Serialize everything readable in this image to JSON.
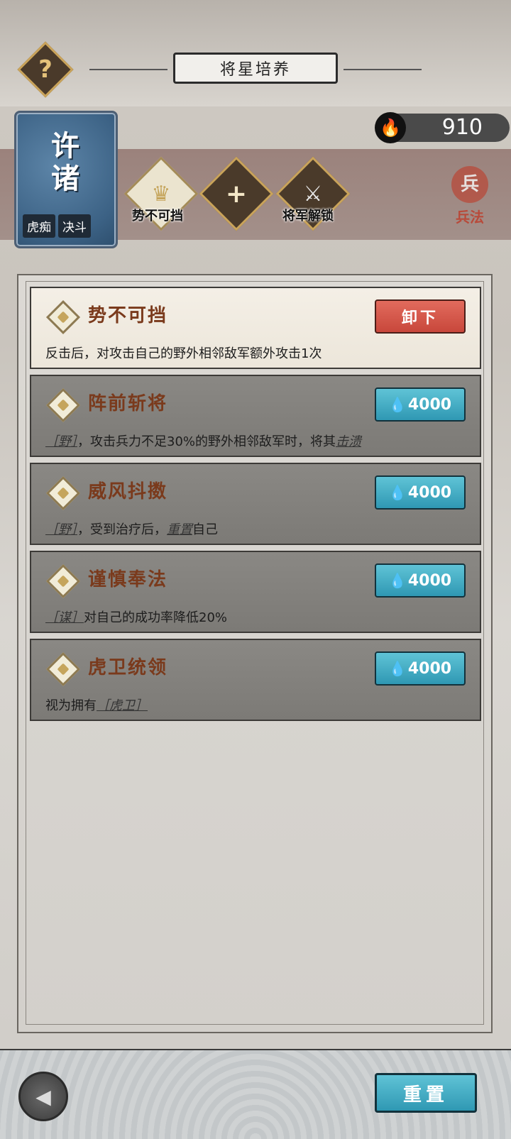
{
  "header": {
    "title": "将星培养",
    "help_glyph": "?"
  },
  "hero": {
    "name_line1": "许",
    "name_line2": "诸",
    "tags": [
      "虎痴",
      "决斗"
    ]
  },
  "currency": {
    "icon": "blue-flame-icon",
    "value": "910"
  },
  "slots": [
    {
      "label": "势不可挡",
      "icon": "crown-emblem-icon"
    },
    {
      "label": "",
      "icon": "plus-icon",
      "glyph": "+"
    },
    {
      "label": "将军解锁",
      "icon": "crossed-swords-icon"
    }
  ],
  "bingfa": {
    "icon_text": "兵",
    "label": "兵法"
  },
  "skills": [
    {
      "name": "势不可挡",
      "desc": "反击后，对攻击自己的野外相邻敌军额外攻击1次",
      "action": "卸下",
      "state": "equipped"
    },
    {
      "name": "阵前斩将",
      "desc_pre": "［野］",
      "desc": "，攻击兵力不足30%的野外相邻敌军时，将其",
      "desc_post": "击溃",
      "cost": "4000",
      "state": "locked"
    },
    {
      "name": "威风抖擞",
      "desc_pre": "［野］",
      "desc": "，受到治疗后，",
      "desc_mid": "重置",
      "desc_post": "自己",
      "cost": "4000",
      "state": "locked"
    },
    {
      "name": "谨慎奉法",
      "desc_pre": "［谋］",
      "desc": "对自己的成功率降低20%",
      "cost": "4000",
      "state": "locked"
    },
    {
      "name": "虎卫统领",
      "desc": "视为拥有",
      "desc_post": "［虎卫］",
      "cost": "4000",
      "state": "locked"
    }
  ],
  "footer": {
    "reset_label": "重置"
  },
  "colors": {
    "accent_blue": "#2f98b3",
    "unload_red": "#c8473b",
    "skill_name": "#7a3a1c"
  }
}
